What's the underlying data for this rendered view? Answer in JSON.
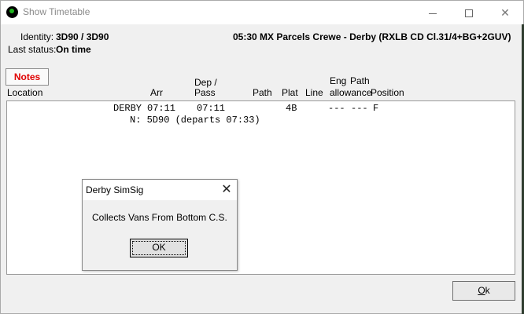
{
  "window": {
    "title": "Show Timetable"
  },
  "header": {
    "identity_label": "Identity:",
    "identity_value": "3D90 / 3D90",
    "status_label": "Last status:",
    "status_value": "On time",
    "train_description": "05:30 MX Parcels Crewe - Derby (RXLB CD Cl.31/4+BG+2GUV)"
  },
  "notes_button": "Notes",
  "columns": {
    "location": "Location",
    "arr": "Arr",
    "dep_top": "Dep /",
    "dep_bottom": "Pass",
    "path": "Path",
    "plat": "Plat",
    "line": "Line",
    "eng_top": "Eng",
    "eng_bottom": "allowance",
    "pathallow_top": "Path",
    "position": "Position"
  },
  "timetable": {
    "rows": [
      {
        "location": "DERBY",
        "arr": "07:11",
        "dep": "07:11",
        "plat": "4B",
        "eng": "---",
        "path_allow": "---",
        "position": "F"
      }
    ],
    "note_line": "N: 5D90 (departs 07:33)"
  },
  "ok_button": {
    "label_underlined": "O",
    "label_rest": "k"
  },
  "dialog": {
    "title": "Derby SimSig",
    "message": "Collects Vans From Bottom C.S.",
    "ok_label": "OK"
  }
}
